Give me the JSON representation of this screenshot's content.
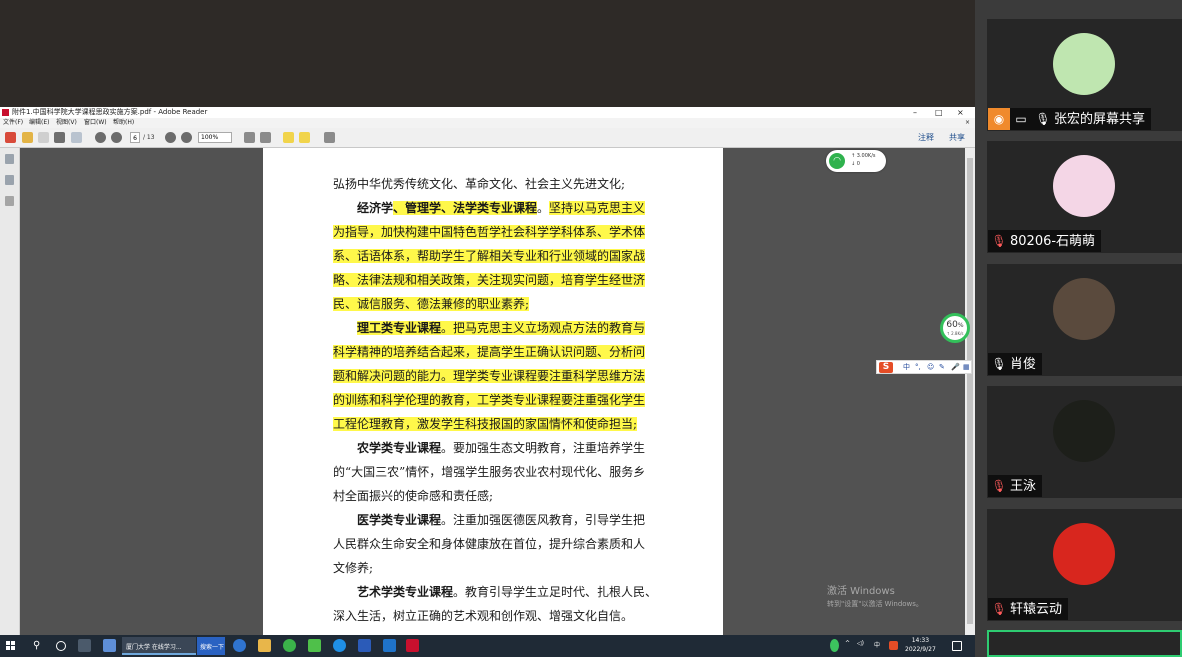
{
  "window": {
    "title": "附件1.中国科学院大学课程思政实施方案.pdf - Adobe Reader",
    "controls": [
      "–",
      "□",
      "×"
    ]
  },
  "menu": [
    "文件(F)",
    "编辑(E)",
    "视图(V)",
    "窗口(W)",
    "帮助(H)"
  ],
  "toolbar": {
    "page_current": "6",
    "page_total": "/ 13",
    "zoom": "100%",
    "annotate_label": "注释",
    "share_label": "共享"
  },
  "document": {
    "lines": [
      {
        "segments": [
          {
            "text": "弘扬中华优秀传统文化、革命文化、社会主义先进文化;",
            "hl": false,
            "bold": false
          }
        ]
      },
      {
        "indent": true,
        "segments": [
          {
            "text": "经济学",
            "hl": false,
            "bold": true
          },
          {
            "text": "、管理学、法学类专业课程",
            "hl": true,
            "bold": true
          },
          {
            "text": "。",
            "hl": false,
            "bold": false
          },
          {
            "text": "坚持以马克思主义",
            "hl": true,
            "bold": false
          }
        ]
      },
      {
        "segments": [
          {
            "text": "为指导，加快构建中国特色哲学社会科学学科体系、学术体",
            "hl": true,
            "bold": false
          }
        ]
      },
      {
        "segments": [
          {
            "text": "系、话语体系，帮助学生了解相关专业和行业领域的国家战",
            "hl": true,
            "bold": false
          }
        ]
      },
      {
        "segments": [
          {
            "text": "略、法律法规和相关政策，关注现实问题，培育学生经世济",
            "hl": true,
            "bold": false
          }
        ]
      },
      {
        "segments": [
          {
            "text": "民、诚信服务、德法兼修的职业素养;",
            "hl": true,
            "bold": false
          }
        ]
      },
      {
        "indent": true,
        "segments": [
          {
            "text": "理工类专业课程",
            "hl": true,
            "bold": true
          },
          {
            "text": "。把马克思主义立场观点方法的教育与",
            "hl": true,
            "bold": false
          }
        ]
      },
      {
        "segments": [
          {
            "text": "科学精神的培养结合起来，提高学生正确认识问题、分析问",
            "hl": true,
            "bold": false
          }
        ]
      },
      {
        "segments": [
          {
            "text": "题和解决问题的能力。理学类专业课程要注重科学思维方法",
            "hl": true,
            "bold": false
          }
        ]
      },
      {
        "segments": [
          {
            "text": "的训练和科学伦理的教育，工学类专业课程要注重强化学生",
            "hl": true,
            "bold": false
          }
        ]
      },
      {
        "segments": [
          {
            "text": "工程伦理教育，激发学生科技报国的家国情怀和使命担当;",
            "hl": true,
            "bold": false
          }
        ]
      },
      {
        "indent": true,
        "segments": [
          {
            "text": "农学类专业课程",
            "hl": false,
            "bold": true
          },
          {
            "text": "。要加强生态文明教育，注重培养学生",
            "hl": false,
            "bold": false
          }
        ]
      },
      {
        "segments": [
          {
            "text": "的“大国三农”情怀，增强学生服务农业农村现代化、服务乡",
            "hl": false,
            "bold": false
          }
        ]
      },
      {
        "segments": [
          {
            "text": "村全面振兴的使命感和责任感;",
            "hl": false,
            "bold": false
          }
        ]
      },
      {
        "indent": true,
        "segments": [
          {
            "text": "医学类专业课程",
            "hl": false,
            "bold": true
          },
          {
            "text": "。注重加强医德医风教育，引导学生把",
            "hl": false,
            "bold": false
          }
        ]
      },
      {
        "segments": [
          {
            "text": "人民群众生命安全和身体健康放在首位，提升综合素质和人",
            "hl": false,
            "bold": false
          }
        ]
      },
      {
        "segments": [
          {
            "text": "文修养;",
            "hl": false,
            "bold": false
          }
        ]
      },
      {
        "indent": true,
        "segments": [
          {
            "text": "艺术学类专业课程",
            "hl": false,
            "bold": true
          },
          {
            "text": "。教育引导学生立足时代、扎根人民、",
            "hl": false,
            "bold": false
          }
        ]
      },
      {
        "segments": [
          {
            "text": "深入生活，树立正确的艺术观和创作观、增强文化自信。",
            "hl": false,
            "bold": false
          }
        ]
      }
    ]
  },
  "network_widget": {
    "upload": "↑ 3.00K/s",
    "download": "↓ 0"
  },
  "percent_widget": {
    "value": "60",
    "unit": "%",
    "speed": "↑ 2.8K/s"
  },
  "ime_bar": {
    "glyphs": [
      "中",
      "°,",
      "☺",
      "✎",
      "🎤",
      "▦"
    ]
  },
  "watermark": {
    "line1": "激活 Windows",
    "line2": "转到\"设置\"以激活 Windows。"
  },
  "taskbar": {
    "task1_label": "厦门大学 在线学习...",
    "task2_label": "搜索一下",
    "clock_time": "14:33",
    "clock_date": "2022/9/27"
  },
  "participants": [
    {
      "name": "张宏的屏幕共享",
      "mic": "on",
      "avatar_color": "#bfe6b0"
    },
    {
      "name": "80206-石萌萌",
      "mic": "off",
      "avatar_color": "#f4d6e6"
    },
    {
      "name": "肖俊",
      "mic": "on",
      "avatar_color": "#5a4a3d"
    },
    {
      "name": "王泳",
      "mic": "off",
      "avatar_color": "#1d1f1a"
    },
    {
      "name": "轩辕云动",
      "mic": "off",
      "avatar_color": "#d8261e"
    }
  ]
}
